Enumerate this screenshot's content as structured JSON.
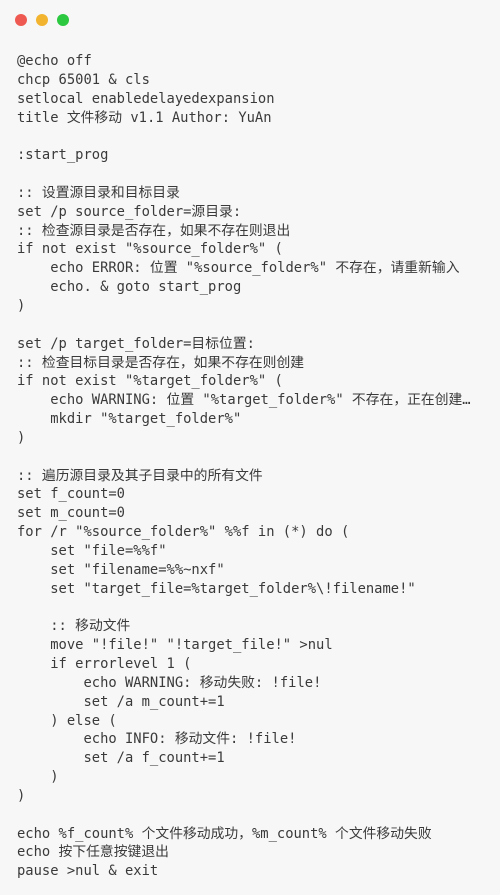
{
  "window": {
    "controls": {
      "close_color": "#ee5a52",
      "minimize_color": "#f2b32f",
      "zoom_color": "#2bc840"
    }
  },
  "editor": {
    "lines": [
      "@echo off",
      "chcp 65001 & cls",
      "setlocal enabledelayedexpansion",
      "title 文件移动 v1.1 Author: YuAn",
      "",
      ":start_prog",
      "",
      ":: 设置源目录和目标目录",
      "set /p source_folder=源目录:",
      ":: 检查源目录是否存在，如果不存在则退出",
      "if not exist \"%source_folder%\" (",
      "    echo ERROR: 位置 \"%source_folder%\" 不存在，请重新输入",
      "    echo. & goto start_prog",
      ")",
      "",
      "set /p target_folder=目标位置:",
      ":: 检查目标目录是否存在，如果不存在则创建",
      "if not exist \"%target_folder%\" (",
      "    echo WARNING: 位置 \"%target_folder%\" 不存在，正在创建…",
      "    mkdir \"%target_folder%\"",
      ")",
      "",
      ":: 遍历源目录及其子目录中的所有文件",
      "set f_count=0",
      "set m_count=0",
      "for /r \"%source_folder%\" %%f in (*) do (",
      "    set \"file=%%f\"",
      "    set \"filename=%%~nxf\"",
      "    set \"target_file=%target_folder%\\!filename!\"",
      "",
      "    :: 移动文件",
      "    move \"!file!\" \"!target_file!\" >nul",
      "    if errorlevel 1 (",
      "        echo WARNING: 移动失败: !file!",
      "        set /a m_count+=1",
      "    ) else (",
      "        echo INFO: 移动文件: !file!",
      "        set /a f_count+=1",
      "    )",
      ")",
      "",
      "echo %f_count% 个文件移动成功，%m_count% 个文件移动失败",
      "echo 按下任意按键退出",
      "pause >nul & exit"
    ]
  }
}
